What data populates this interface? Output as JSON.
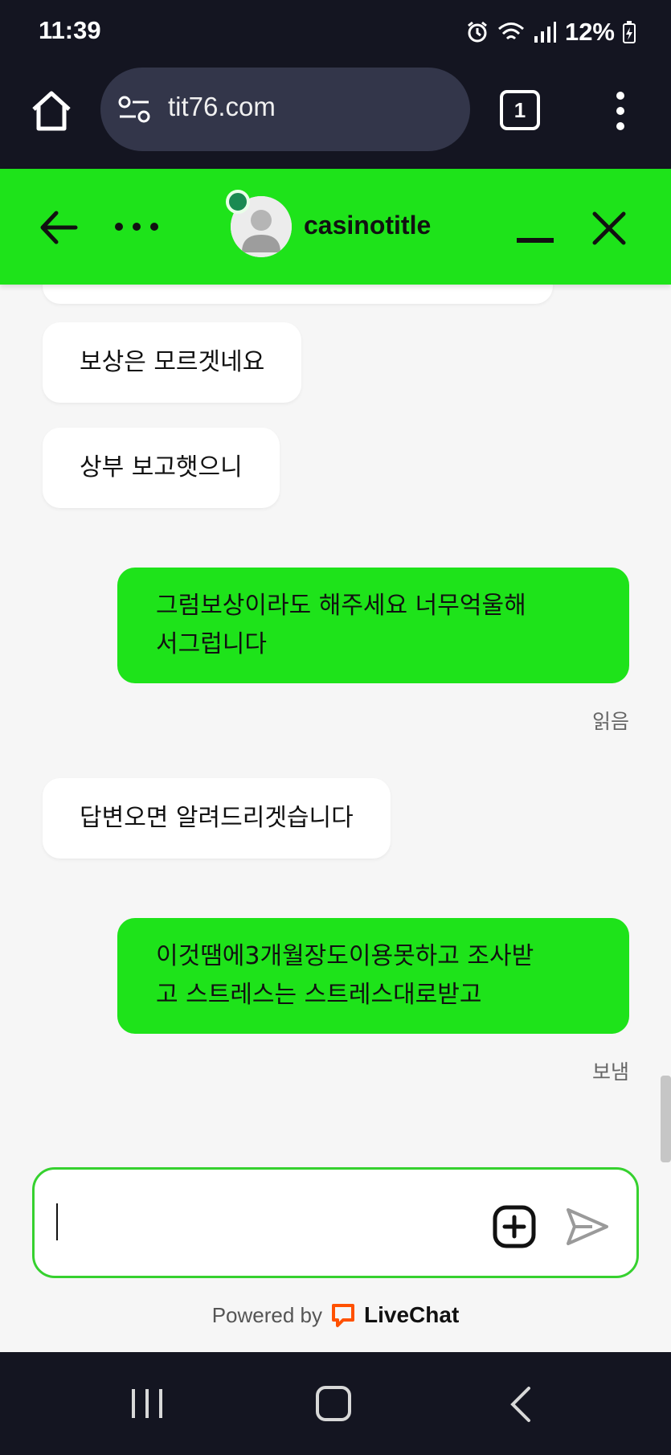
{
  "status_bar": {
    "time": "11:39",
    "battery_percent": "12%",
    "icons": [
      "alarm-icon",
      "wifi-icon",
      "signal-icon",
      "battery-charging-icon"
    ]
  },
  "browser": {
    "url": "tit76.com",
    "tab_count": "1"
  },
  "chat_header": {
    "agent_name": "casinotitle",
    "online": true
  },
  "messages": [
    {
      "sender": "agent",
      "text": "보상은 모르겟네요"
    },
    {
      "sender": "agent",
      "text": "상부 보고햇으니"
    },
    {
      "sender": "visitor",
      "lines": [
        "그럼보상이라도 해주세요 너무억울해",
        "서그럽니다"
      ],
      "status": "읽음"
    },
    {
      "sender": "agent",
      "text": "답변오면 알려드리겟습니다"
    },
    {
      "sender": "visitor",
      "lines": [
        "이것땜에3개월장도이용못하고 조사받",
        "고 스트레스는 스트레스대로받고"
      ],
      "status": "보냄"
    }
  ],
  "composer": {
    "value": "",
    "placeholder": ""
  },
  "footer": {
    "powered_by": "Powered by",
    "brand": "LiveChat"
  },
  "colors": {
    "accent": "#1ee31a",
    "dark_bar": "#141521",
    "chat_bg": "#f6f6f6",
    "brand_orange": "#ff5100"
  }
}
